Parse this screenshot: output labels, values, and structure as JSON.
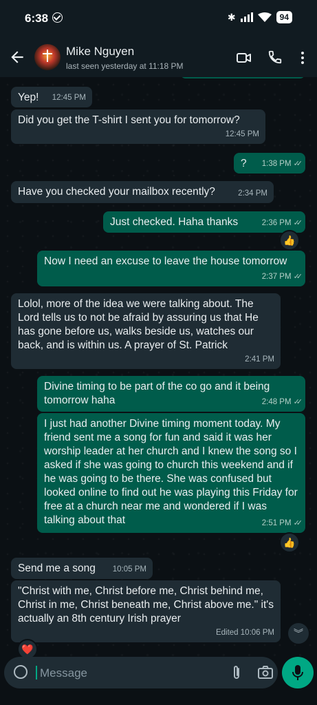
{
  "status_bar": {
    "time": "6:38",
    "battery": "94"
  },
  "header": {
    "name": "Mike Nguyen",
    "last_seen": "last seen yesterday at 11:18 PM"
  },
  "messages": [
    {
      "dir": "in",
      "text": "Yep!",
      "time": "12:45 PM"
    },
    {
      "dir": "in",
      "text": "Did you get the T-shirt I sent you for tomorrow?",
      "time": "12:45 PM"
    },
    {
      "dir": "out",
      "text": "?",
      "time": "1:38 PM",
      "read": true
    },
    {
      "dir": "in",
      "text": "Have you checked your mailbox recently?",
      "time": "2:34 PM"
    },
    {
      "dir": "out",
      "text": "Just checked. Haha thanks",
      "time": "2:36 PM",
      "read": true,
      "reaction": "👍"
    },
    {
      "dir": "out",
      "text": "Now I need an excuse to leave the house tomorrow",
      "time": "2:37 PM",
      "read": true
    },
    {
      "dir": "in",
      "text": "Lolol, more of the idea we were talking about. The Lord tells us to not be afraid by assuring us that He has gone before us, walks beside us, watches our back, and is within us. A prayer of St. Patrick",
      "time": "2:41 PM"
    },
    {
      "dir": "out",
      "text": "Divine timing to be part of the co go and it being tomorrow haha",
      "time": "2:48 PM",
      "read": true
    },
    {
      "dir": "out",
      "text": "I just had another Divine timing moment today. My friend sent me a song for fun and said it was her worship leader at her church and I knew the song so I asked if she was going to church this weekend and if he was going to be there. She was confused but looked online to find out he was playing this Friday for free at a church near me and wondered if I was talking about that",
      "time": "2:51 PM",
      "read": true,
      "reaction": "👍"
    },
    {
      "dir": "in",
      "text": "Send me a song",
      "time": "10:05 PM"
    },
    {
      "dir": "in",
      "text": "\"Christ with me, Christ before me, Christ behind me, Christ in me, Christ beneath me, Christ above me.\" it's actually an 8th century Irish prayer",
      "time": "Edited 10:06 PM",
      "reaction": "❤️"
    }
  ],
  "input": {
    "placeholder": "Message"
  },
  "icons": {
    "back": "back-arrow-icon",
    "video": "video-call-icon",
    "call": "phone-icon",
    "menu": "more-vert-icon",
    "sticker": "sticker-icon",
    "attach": "paperclip-icon",
    "camera": "camera-icon",
    "mic": "mic-icon",
    "scroll": "double-chevron-down-icon"
  },
  "colors": {
    "incoming": "#1f2c34",
    "outgoing": "#005c4b",
    "accent": "#00a884",
    "background": "#0b1014"
  }
}
